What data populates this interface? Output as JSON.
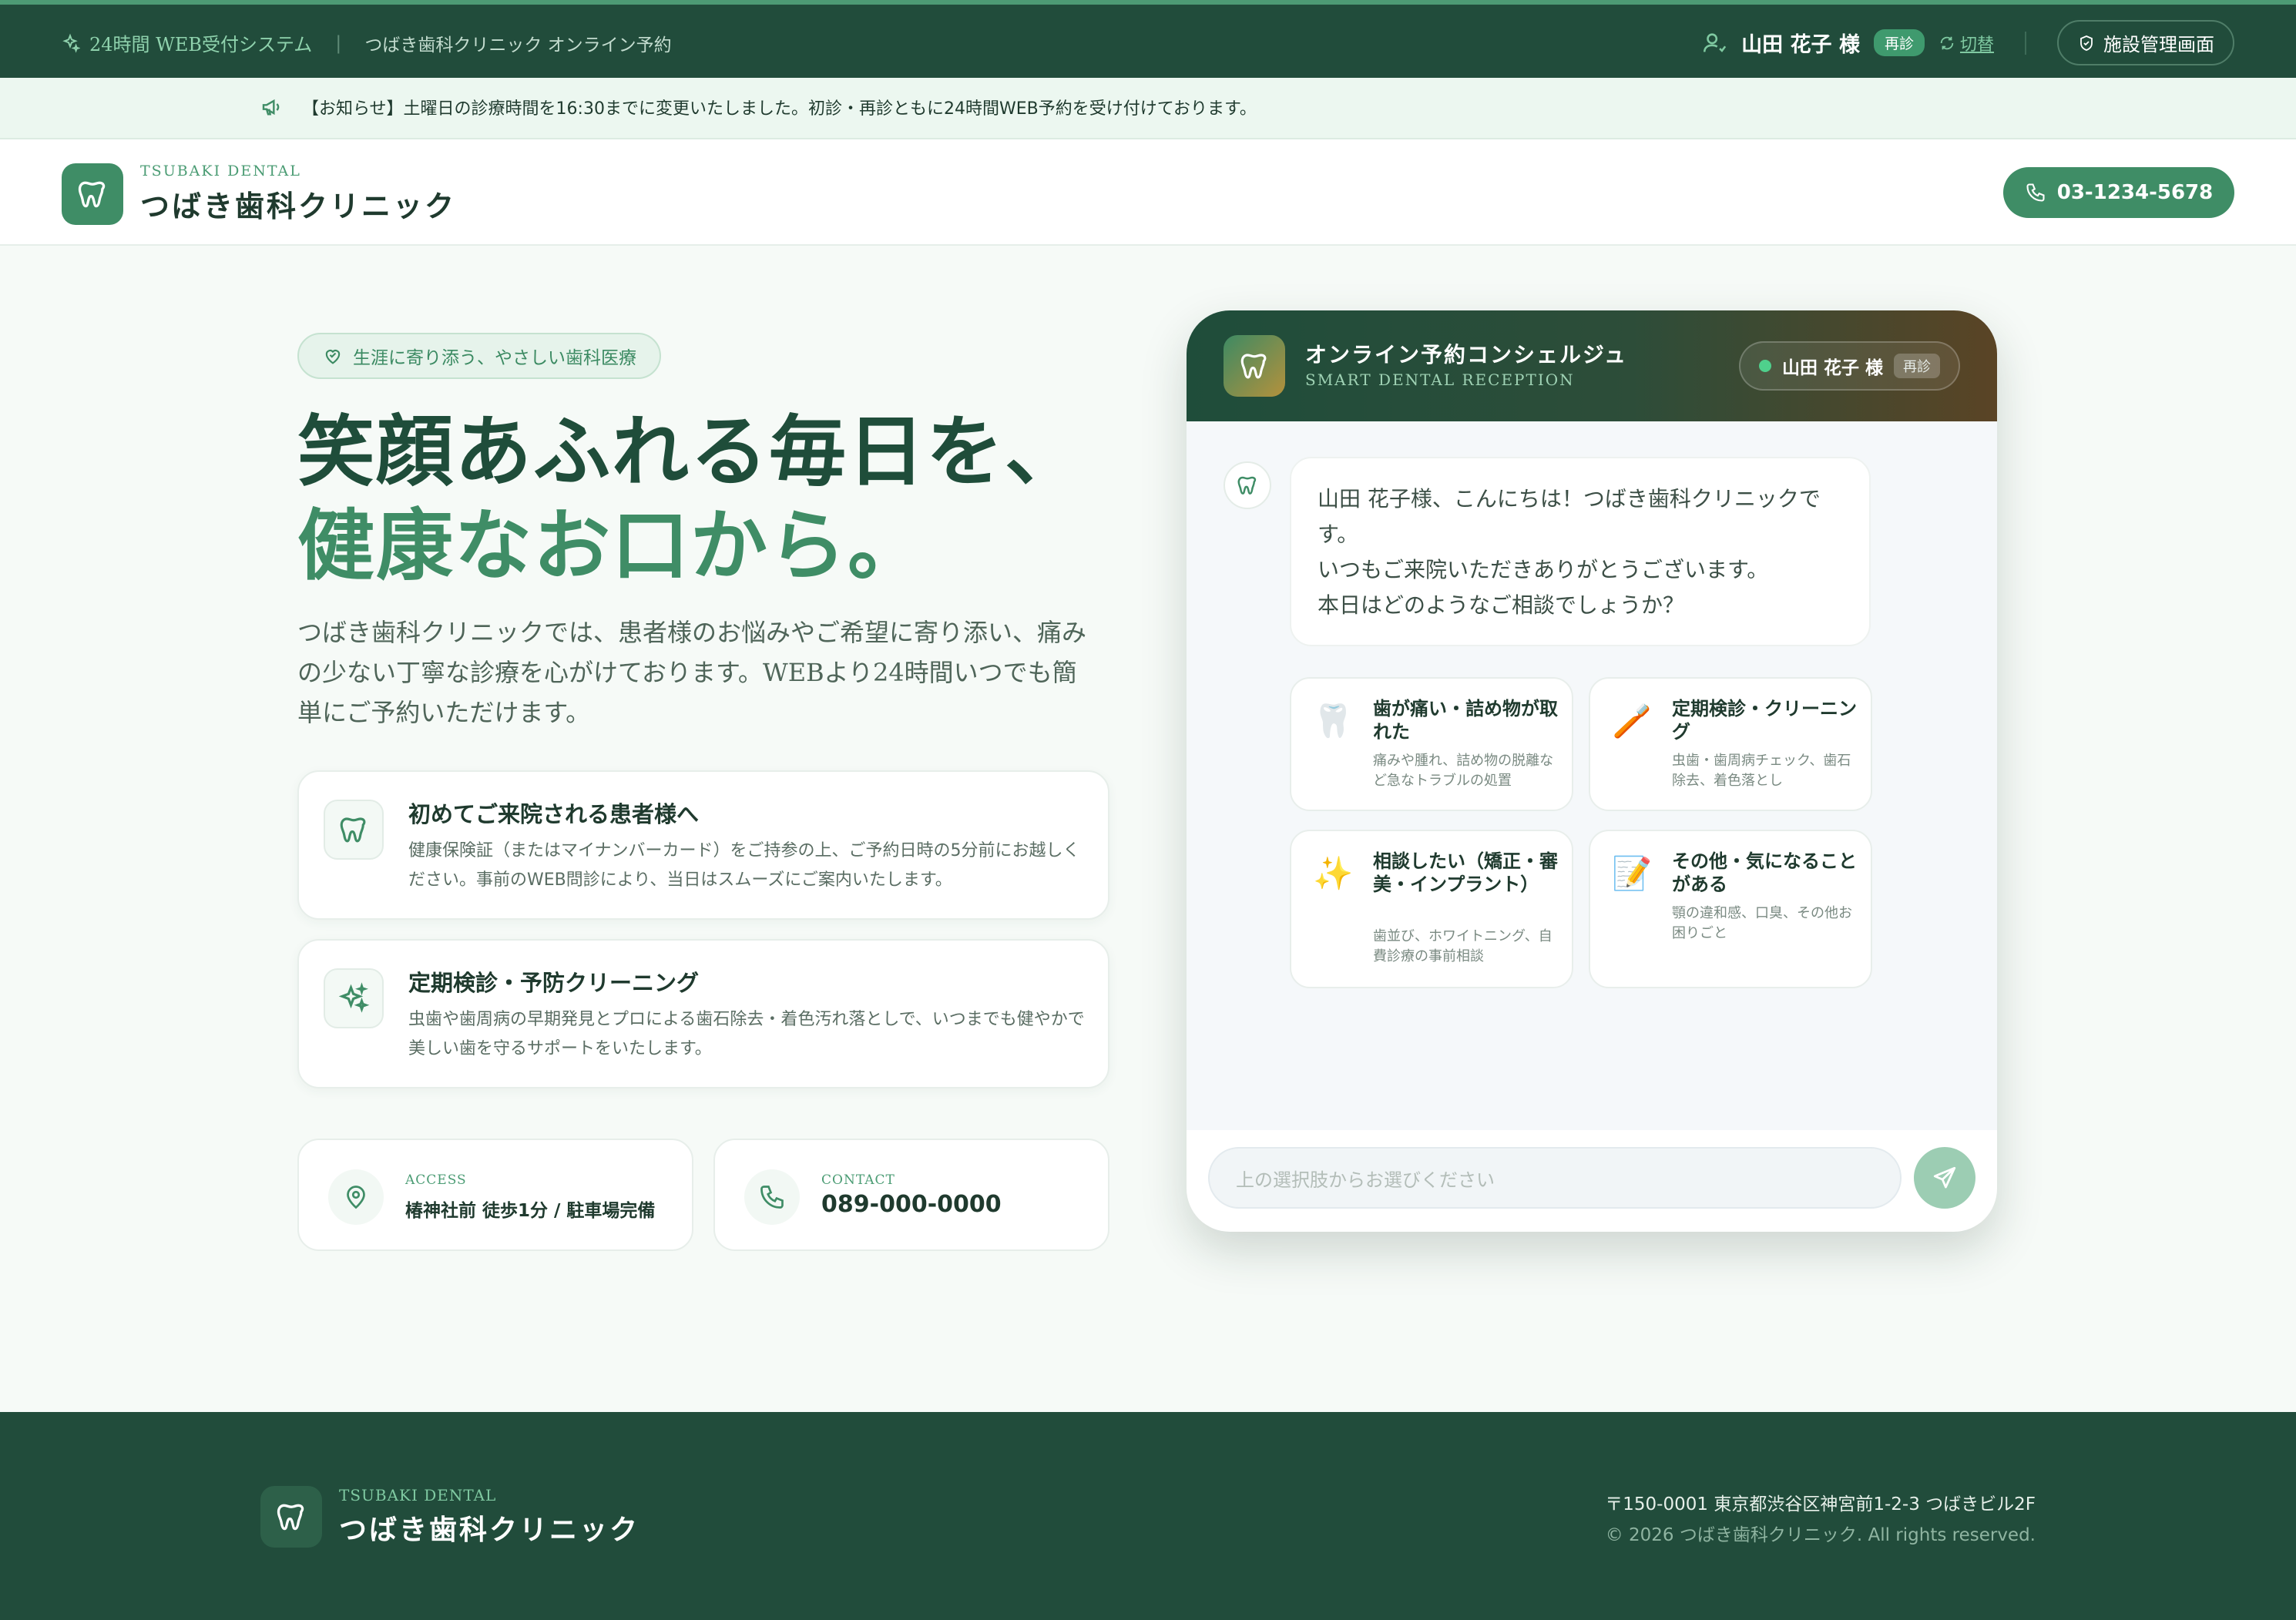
{
  "topbar": {
    "system_label": "24時間 WEB受付システム",
    "separator": "|",
    "clinic_label": "つばき歯科クリニック オンライン予約",
    "user_name": "山田 花子 様",
    "user_badge": "再診",
    "switch_label": "切替",
    "admin_label": "施設管理画面"
  },
  "notice": {
    "text": "【お知らせ】土曜日の診療時間を16:30までに変更いたしました。初診・再診ともに24時間WEB予約を受け付けております。"
  },
  "header": {
    "logo_sub": "TSUBAKI DENTAL",
    "logo_name": "つばき歯科クリニック",
    "phone": "03-1234-5678"
  },
  "hero": {
    "tagline": "生涯に寄り添う、やさしい歯科医療",
    "title_line1": "笑顔あふれる毎日を、",
    "title_line2": "健康なお口から。",
    "description": "つばき歯科クリニックでは、患者様のお悩みやご希望に寄り添い、痛みの少ない丁寧な診療を心がけております。WEBより24時間いつでも簡単にご予約いただけます。"
  },
  "info_cards": [
    {
      "icon": "tooth-icon",
      "title": "初めてご来院される患者様へ",
      "text": "健康保険証（またはマイナンバーカード）をご持参の上、ご予約日時の5分前にお越しください。事前のWEB問診により、当日はスムーズにご案内いたします。"
    },
    {
      "icon": "sparkles-icon",
      "title": "定期検診・予防クリーニング",
      "text": "虫歯や歯周病の早期発見とプロによる歯石除去・着色汚れ落としで、いつまでも健やかで美しい歯を守るサポートをいたします。"
    }
  ],
  "access": {
    "label": "ACCESS",
    "value": "椿神社前 徒歩1分 / 駐車場完備"
  },
  "contact": {
    "label": "CONTACT",
    "value": "089-000-0000"
  },
  "chat": {
    "title": "オンライン予約コンシェルジュ",
    "subtitle": "SMART DENTAL RECEPTION",
    "user_name": "山田 花子 様",
    "user_badge": "再診",
    "greeting": [
      "山田 花子様、こんにちは！つばき歯科クリニックで",
      "す。",
      "いつもご来院いただきありがとうございます。",
      "本日はどのようなご相談でしょうか？"
    ],
    "options": [
      {
        "emoji": "🦷",
        "title": "歯が痛い・詰め物が取れた",
        "desc": "痛みや腫れ、詰め物の脱離など急なトラブルの処置"
      },
      {
        "emoji": "🪥",
        "title": "定期検診・クリーニング",
        "desc": "虫歯・歯周病チェック、歯石除去、着色落とし"
      },
      {
        "emoji": "✨",
        "title": "相談したい（矯正・審美・インプラント）",
        "desc": "歯並び、ホワイトニング、自費診療の事前相談"
      },
      {
        "emoji": "📝",
        "title": "その他・気になることがある",
        "desc": "顎の違和感、口臭、その他お困りごと"
      }
    ],
    "input_placeholder": "上の選択肢からお選びください"
  },
  "footer": {
    "logo_sub": "TSUBAKI DENTAL",
    "logo_name": "つばき歯科クリニック",
    "address": "〒150-0001 東京都渋谷区神宮前1-2-3 つばきビル2F",
    "copyright": "© 2026 つばき歯科クリニック. All rights reserved."
  },
  "colors": {
    "primary_dark": "#214c3b",
    "primary": "#3f8d66",
    "accent_light": "#ecf7f0",
    "gold": "#b4913c"
  }
}
